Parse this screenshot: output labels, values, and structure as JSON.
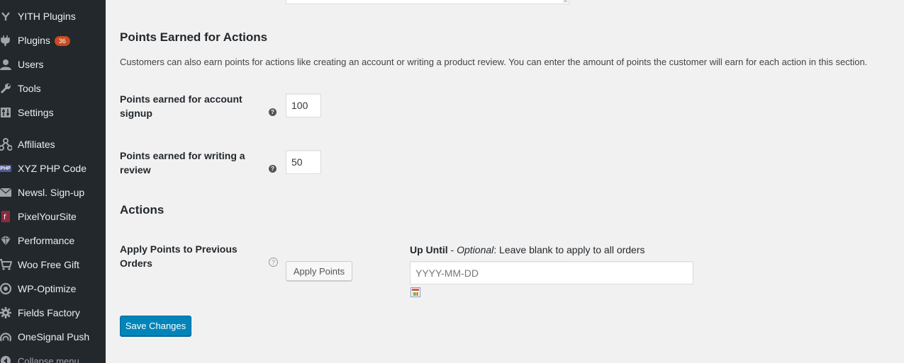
{
  "sidebar": {
    "items": [
      {
        "label": "YITH Plugins",
        "icon": "yith-icon"
      },
      {
        "label": "Plugins",
        "icon": "plugin-icon",
        "badge": "36"
      },
      {
        "label": "Users",
        "icon": "users-icon"
      },
      {
        "label": "Tools",
        "icon": "wrench-icon"
      },
      {
        "label": "Settings",
        "icon": "settings-icon"
      },
      {
        "label": "Affiliates",
        "icon": "affiliates-icon"
      },
      {
        "label": "XYZ PHP Code",
        "icon": "php-icon",
        "icon_text": "PHP"
      },
      {
        "label": "Newsl. Sign-up",
        "icon": "mail-icon"
      },
      {
        "label": "PixelYourSite",
        "icon": "pixelyoursite-icon"
      },
      {
        "label": "Performance",
        "icon": "performance-icon"
      },
      {
        "label": "Woo Free Gift",
        "icon": "cart-icon"
      },
      {
        "label": "WP-Optimize",
        "icon": "wp-optimize-icon"
      },
      {
        "label": "Fields Factory",
        "icon": "gear-icon"
      },
      {
        "label": "OneSignal Push",
        "icon": "onesignal-icon"
      },
      {
        "label": "Collapse menu",
        "icon": "collapse-icon"
      }
    ]
  },
  "points_section": {
    "title": "Points Earned for Actions",
    "description": "Customers can also earn points for actions like creating an account or writing a product review. You can enter the amount of points the customer will earn for each action in this section.",
    "signup_label": "Points earned for account signup",
    "signup_value": "100",
    "review_label": "Points earned for writing a review",
    "review_value": "50",
    "help_glyph": "?"
  },
  "actions_section": {
    "title": "Actions",
    "apply_label": "Apply Points to Previous Orders",
    "apply_button": "Apply Points",
    "until_bold": "Up Until",
    "until_sep": " - ",
    "until_italic": "Optional",
    "until_rest": ": Leave blank to apply to all orders",
    "date_placeholder": "YYYY-MM-DD"
  },
  "save_button": "Save Changes",
  "colors": {
    "sidebar_bg": "#23282d",
    "badge": "#ca4a1f",
    "primary_button": "#0085ba"
  }
}
